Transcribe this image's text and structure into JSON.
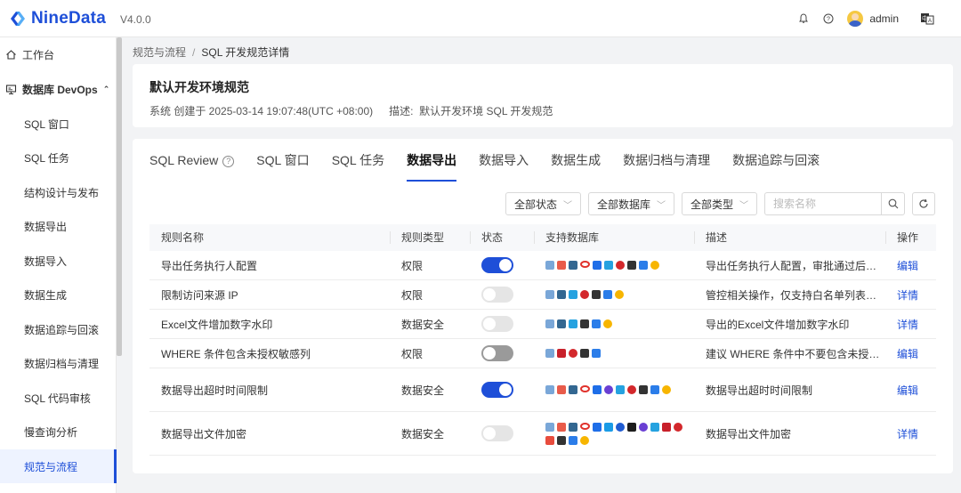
{
  "app": {
    "name": "NineData",
    "version": "V4.0.0",
    "username": "admin"
  },
  "sidebar": {
    "items": [
      {
        "label": "工作台",
        "icon": "home-icon"
      },
      {
        "label": "数据库 DevOps",
        "icon": "database-devops-icon"
      },
      {
        "label": "SQL 窗口"
      },
      {
        "label": "SQL 任务"
      },
      {
        "label": "结构设计与发布"
      },
      {
        "label": "数据导出"
      },
      {
        "label": "数据导入"
      },
      {
        "label": "数据生成"
      },
      {
        "label": "数据追踪与回滚"
      },
      {
        "label": "数据归档与清理"
      },
      {
        "label": "SQL 代码审核"
      },
      {
        "label": "慢查询分析"
      },
      {
        "label": "规范与流程"
      }
    ]
  },
  "breadcrumb": {
    "parent": "规范与流程",
    "separator": "/",
    "current": "SQL 开发规范详情"
  },
  "spec": {
    "title": "默认开发环境规范",
    "meta": "系统 创建于 2025-03-14 19:07:48(UTC +08:00)",
    "desc_label": "描述:",
    "desc": "默认开发环境 SQL 开发规范"
  },
  "tabs": [
    {
      "label": "SQL Review",
      "help": "?"
    },
    {
      "label": "SQL 窗口"
    },
    {
      "label": "SQL 任务"
    },
    {
      "label": "数据导出"
    },
    {
      "label": "数据导入"
    },
    {
      "label": "数据生成"
    },
    {
      "label": "数据归档与清理"
    },
    {
      "label": "数据追踪与回滚"
    }
  ],
  "filters": {
    "status": "全部状态",
    "database": "全部数据库",
    "type": "全部类型",
    "search_placeholder": "搜索名称"
  },
  "table": {
    "headers": [
      "规则名称",
      "规则类型",
      "状态",
      "支持数据库",
      "描述",
      "操作"
    ],
    "rows": [
      {
        "name": "导出任务执行人配置",
        "type": "权限",
        "enabled": true,
        "desc": "导出任务执行人配置，审批通过后自…",
        "action": "编辑"
      },
      {
        "name": "限制访问来源 IP",
        "type": "权限",
        "enabled": false,
        "desc": "管控相关操作，仅支持白名单列表中…",
        "action": "详情"
      },
      {
        "name": "Excel文件增加数字水印",
        "type": "数据安全",
        "enabled": false,
        "desc": "导出的Excel文件增加数字水印",
        "action": "详情"
      },
      {
        "name": "WHERE 条件包含未授权敏感列",
        "type": "权限",
        "enabled": false,
        "desc": "建议 WHERE 条件中不要包含未授权敏…",
        "action": "编辑"
      },
      {
        "name": "数据导出超时时间限制",
        "type": "数据安全",
        "enabled": true,
        "desc": "数据导出超时时间限制",
        "action": "编辑"
      },
      {
        "name": "数据导出文件加密",
        "type": "数据安全",
        "enabled": false,
        "desc": "数据导出文件加密",
        "action": "详情"
      }
    ]
  },
  "colors": {
    "accent": "#1e4fd8",
    "toggle_off": "#e5e5e5"
  }
}
